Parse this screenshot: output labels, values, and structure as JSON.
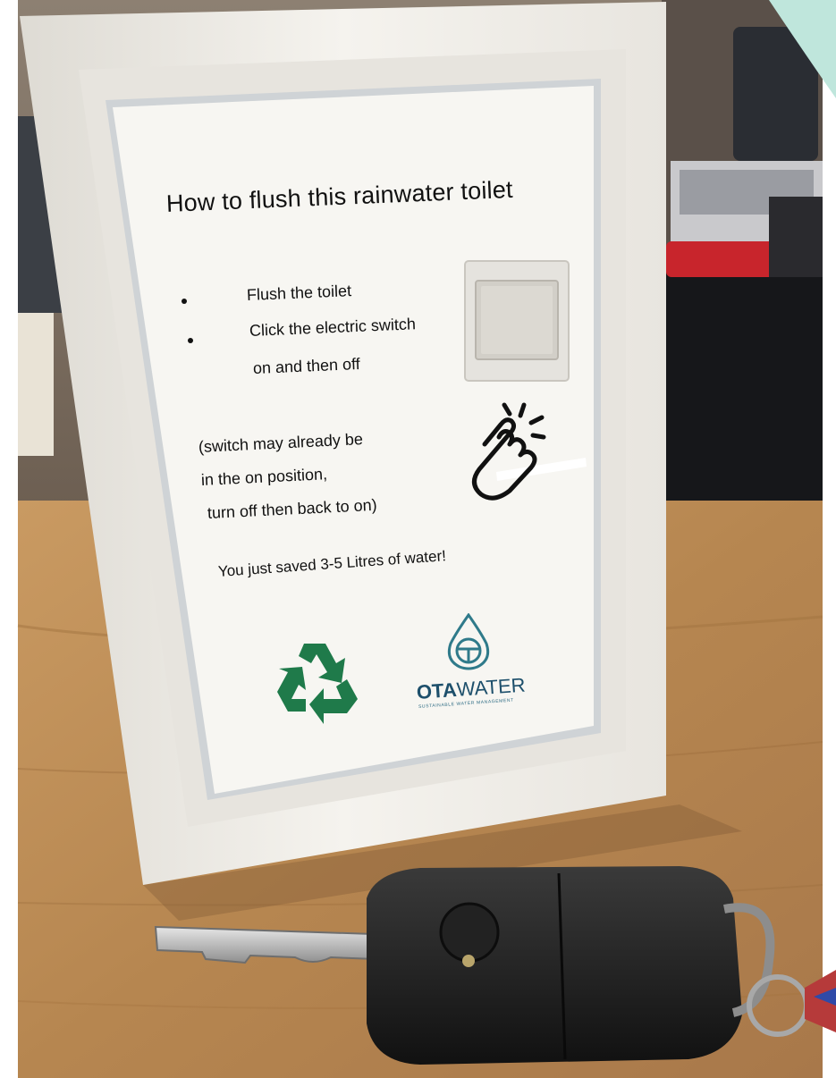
{
  "sign": {
    "title": "How to flush this rainwater toilet",
    "steps": [
      "Flush the toilet",
      "Click the electric switch",
      "on and then off"
    ],
    "note_lines": [
      "(switch may already be",
      "in the on position,",
      "turn off then back to on)"
    ],
    "saved_message": "You just saved 3-5 Litres of water!"
  },
  "logo": {
    "brand_bold": "OTA",
    "brand_regular": "WATER",
    "tagline": "SUSTAINABLE WATER MANAGEMENT"
  },
  "icons": [
    "light-switch-icon",
    "tap-hand-icon",
    "recycle-icon",
    "water-drop-logo-icon",
    "car-key-icon"
  ],
  "colors": {
    "recycle_green": "#1f7a4a",
    "logo_teal": "#2f7a8a",
    "logo_navy": "#1d4f6b",
    "frame_white": "#f3f1ec",
    "table_wood": "#b88a55"
  }
}
